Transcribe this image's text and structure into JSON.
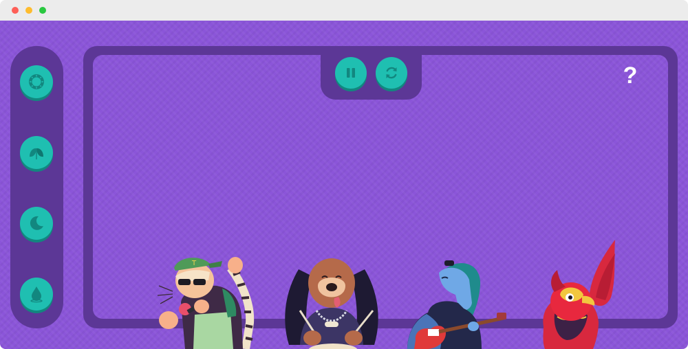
{
  "window": {
    "controls": [
      "close",
      "minimize",
      "zoom"
    ]
  },
  "sidebar": {
    "buttons": [
      {
        "name": "sun-icon"
      },
      {
        "name": "leaves-icon"
      },
      {
        "name": "moon-icon"
      },
      {
        "name": "water-drop-icon"
      }
    ]
  },
  "player": {
    "buttons": [
      {
        "name": "pause-icon"
      },
      {
        "name": "refresh-icon"
      }
    ]
  },
  "help": {
    "label": "?"
  },
  "band": [
    "tiger-singer",
    "dog-drummer",
    "horse-guitarist",
    "phoenix-bird"
  ],
  "colors": {
    "background": "#8b55d9",
    "panel": "#5c3796",
    "button": "#1fbfb1",
    "button_icon": "#12877f",
    "help_text": "#ffffff"
  }
}
